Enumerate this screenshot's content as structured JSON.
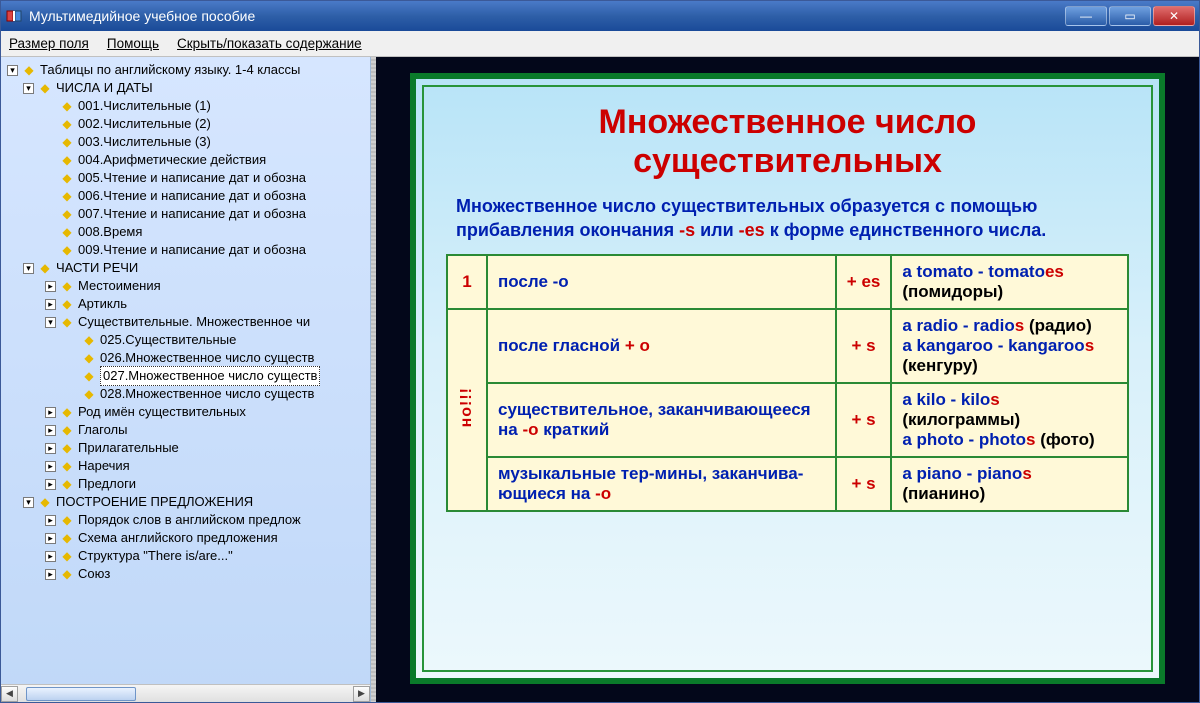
{
  "window": {
    "title": "Мультимедийное учебное пособие"
  },
  "menu": {
    "field_size": "Размер поля",
    "help": "Помощь",
    "toggle_toc": "Скрыть/показать содержание"
  },
  "tree": {
    "root": "Таблицы по английскому языку. 1-4 классы",
    "sec1": "ЧИСЛА И ДАТЫ",
    "s1_001": "001.Числительные (1)",
    "s1_002": "002.Числительные (2)",
    "s1_003": "003.Числительные (3)",
    "s1_004": "004.Арифметические действия",
    "s1_005": "005.Чтение и написание дат и обозна",
    "s1_006": "006.Чтение и написание дат и обозна",
    "s1_007": "007.Чтение и написание дат и обозна",
    "s1_008": "008.Время",
    "s1_009": "009.Чтение и написание дат и обозна",
    "sec2": "ЧАСТИ РЕЧИ",
    "s2_pron": "Местоимения",
    "s2_art": "Артикль",
    "s2_noun": "Существительные. Множественное чи",
    "s2_025": "025.Существительные",
    "s2_026": "026.Множественное число существ",
    "s2_027": "027.Множественное число существ",
    "s2_028": "028.Множественное число существ",
    "s2_gender": "Род имён существительных",
    "s2_verb": "Глаголы",
    "s2_adj": "Прилагательные",
    "s2_adv": "Наречия",
    "s2_prep": "Предлоги",
    "sec3": "ПОСТРОЕНИЕ ПРЕДЛОЖЕНИЯ",
    "s3_order": "Порядок слов в английском предлож",
    "s3_scheme": "Схема английского предложения",
    "s3_there": "Структура \"There is/are...\"",
    "s3_conj": "Союз"
  },
  "slide": {
    "title": "Множественное число существительных",
    "intro_a": "Множественное число существительных образуется с помощью прибавления окончания ",
    "intro_s": "-s",
    "intro_b": " или ",
    "intro_es": "-es",
    "intro_c": " к форме единственного числа.",
    "num": "1",
    "but": "но!!!",
    "r1_rule": "после -о",
    "r1_suf": "+ es",
    "r1_ex_a": "a tomato - tomato",
    "r1_ex_b": "es",
    "r1_ex_c": " (помидоры)",
    "r2_rule_a": "после гласной ",
    "r2_rule_b": "+ о",
    "r2_suf": "+ s",
    "r2_ex1_a": "a radio - radio",
    "r2_ex1_b": "s",
    "r2_ex1_c": " (радио)",
    "r2_ex2_a": "a kangaroo - kangaroo",
    "r2_ex2_b": "s",
    "r2_ex2_c": " (кенгуру)",
    "r3_rule_a": "существительное, заканчивающееся на ",
    "r3_rule_b": "-о",
    "r3_rule_c": " краткий",
    "r3_suf": "+ s",
    "r3_ex1_a": "a kilo - kilo",
    "r3_ex1_b": "s",
    "r3_ex1_c": " (килограммы)",
    "r3_ex2_a": "a photo - photo",
    "r3_ex2_b": "s",
    "r3_ex2_c": " (фото)",
    "r4_rule_a": "музыкальные тер-мины, заканчива-ющиеся на ",
    "r4_rule_b": "-о",
    "r4_suf": "+ s",
    "r4_ex_a": "a piano - piano",
    "r4_ex_b": "s",
    "r4_ex_c": " (пианино)"
  }
}
